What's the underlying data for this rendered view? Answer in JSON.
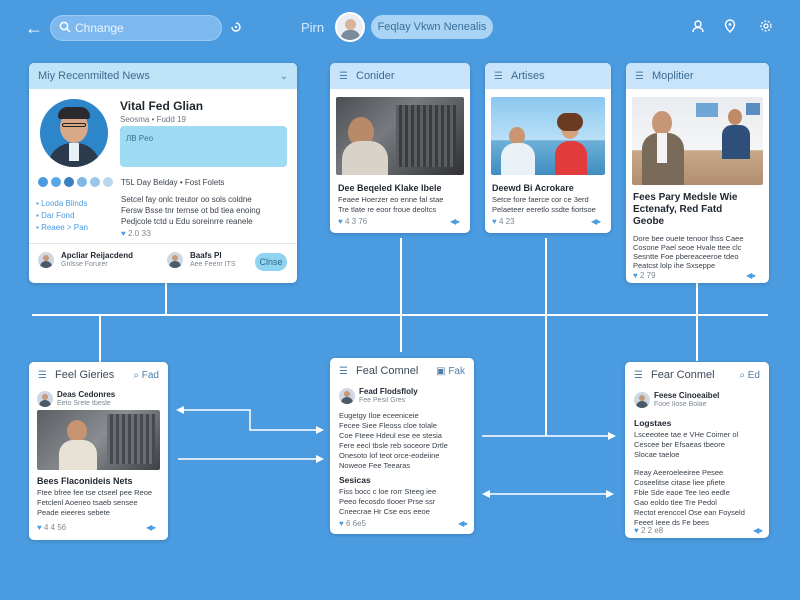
{
  "topbar": {
    "search_value": "Chnange",
    "brand": "Pirn",
    "pill_label": "Feqlay Vkwn Nenealis"
  },
  "profile_card": {
    "title": "Miy Recenmilted News",
    "name": "Vital Fed Glian",
    "subtitle": "Seosma  •  Fudd 19",
    "status_label": "ЛВ Peo",
    "tagline": "T5L Day Belday • Fost Folets",
    "links": [
      "Looda Blinds",
      "Dar Fond",
      "Reaee > Pan"
    ],
    "body": [
      "Setcel fay onlc treutor oo sols coldne",
      "Fersw Bsse tnr ternse ot bd tiea enoing",
      "Pedjcole tctd u Edu soreinrre reanele"
    ],
    "meta": "2.0 ЗЗ",
    "people": [
      {
        "name": "Apcliar Reijacdend",
        "sub": "Gnlsse Forurer"
      },
      {
        "name": "Baafs Pl",
        "sub": "Aee Feenr ITS"
      }
    ],
    "action_label": "Clnse"
  },
  "cards": {
    "contider": {
      "title": "Conider",
      "headline": "Dee Beqeled Klake Ibele",
      "lines": [
        "Feaee Hoerzer eo enne fal stae",
        "Tre tlate re eoor froue deoltcs"
      ],
      "meta": "4 3 76"
    },
    "artises": {
      "title": "Artises",
      "headline": "Deewd Bi Acrokare",
      "lines": [
        "Setce fore faerce cor ce 3erd",
        "Pelaeteer eeretlo ssdte fiortsoe"
      ],
      "meta": "4 23"
    },
    "moplitier": {
      "title": "Moplitier",
      "headline": [
        "Fees Pary Medsle Wie",
        "Ectenafy, Red Fatd",
        "Geobe"
      ],
      "lines": [
        "Dore bee ouete tenoor lhss Caee",
        "Cosone Pael seoe Hvale ttee clc",
        "Sesntte Foe pbereaceeroe tdeo",
        "Peatcst lolp ihe Sxseppe"
      ],
      "meta": "2 79"
    },
    "feel_gieries": {
      "title": "Feel Gieries",
      "right": "Fad",
      "author": "Deas Cedonres",
      "author_sub": "Eeto Srete tbesle",
      "headline": "Bees Flaconideis Nets",
      "lines": [
        "Ftee bfree fee tse ctseel pee Reoe",
        "Fetclenl Aoeneo tsaeb sensee",
        "Peade eieeres sebete"
      ],
      "meta": "4 4 56"
    },
    "feal_comnel": {
      "title": "Feal Comnel",
      "right": "Fak",
      "author": "Fead Flodsfloly",
      "author_sub": "Fee Pesil Gres",
      "lines": [
        "Eugetgy Iloe eceeniceie",
        "Fecee Siee Fleoss cloe tolale",
        "Coe Fteee Hdeul ese ee stesia",
        "Fere eecl tbsle reb soceore Drtle",
        "Onesoto lof teot orce-eodeiine",
        "Noweoe Fee Teearas"
      ],
      "section": "Sesicas",
      "section_lines": [
        "Fiss bocc c loe rorr Steeg iee",
        "Peeo fecosdo tlooer Prse ssr",
        "Cneecrae Hr Cse eos eeoe"
      ],
      "meta": "6 6e5"
    },
    "fear_conmel": {
      "title": "Fear Conmel",
      "right": "Ed",
      "author": "Feese Cinoeaibel",
      "author_sub": "Fooe Ilose Bolae",
      "section": "Logstaes",
      "lines": [
        "Lsceeotee tae e VHe Coimer ol",
        "Cescee ber Efsaeas tbeore",
        "Slocae taeloe"
      ],
      "lines2": [
        "Reay Aeeroeleeiree Pesee",
        "Coseelitse citase liee pfiete",
        "Fble Sde eaoe Tee Ieo eedle",
        "Gao eoldo tlee Tre Pedol",
        "Rectot erenccel Ose ean Foyseld",
        "Feeet Ieee ds Fe bees"
      ],
      "meta": "2 2 e8"
    }
  },
  "colors": {
    "background": "#4a9be0",
    "card_header": "#c8e4fa",
    "accent": "#4a9be0",
    "pill": "#8fd3f0"
  }
}
